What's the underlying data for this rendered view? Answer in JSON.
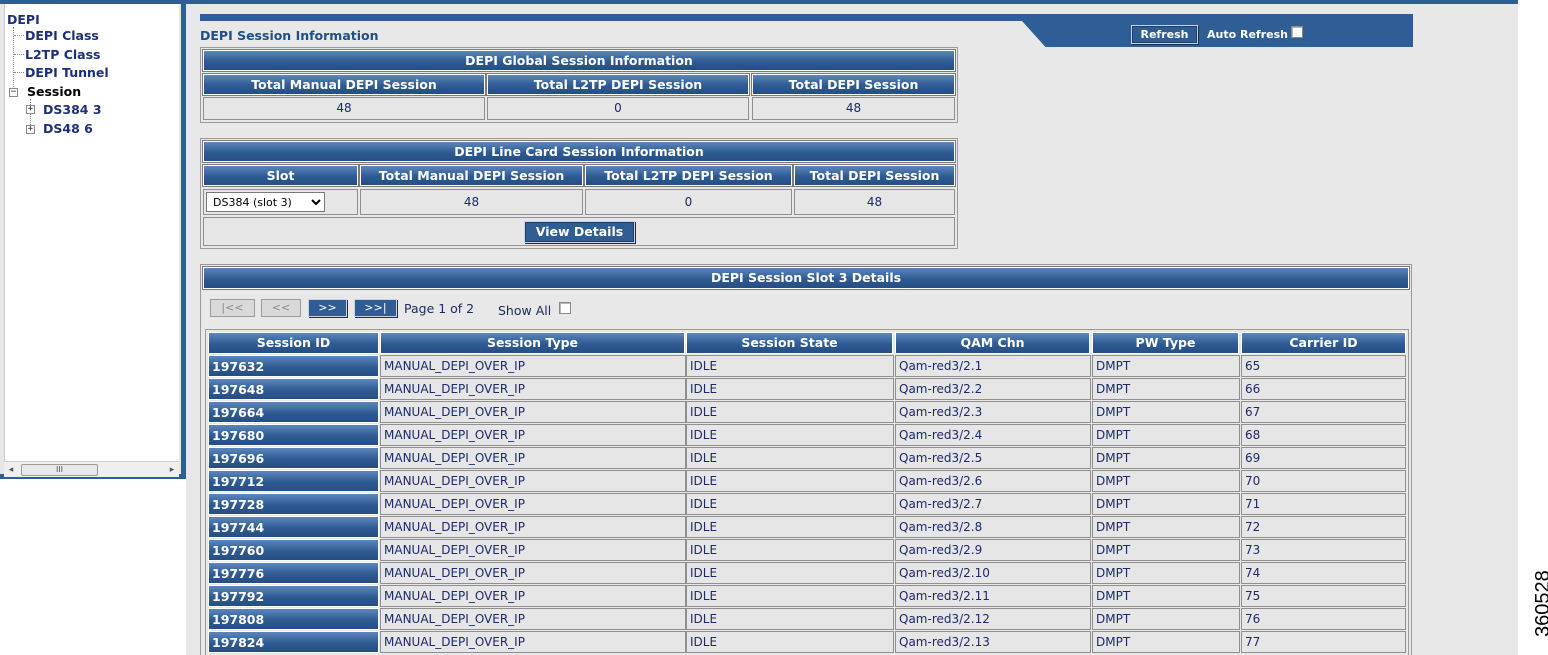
{
  "tree": {
    "root": "DEPI",
    "items": [
      {
        "label": "DEPI Class"
      },
      {
        "label": "L2TP Class"
      },
      {
        "label": "DEPI Tunnel"
      },
      {
        "label": "Session",
        "expander": "⊟"
      },
      {
        "label": "DS384 3",
        "expander": "⊞"
      },
      {
        "label": "DS48 6",
        "expander": "⊞"
      }
    ],
    "scroll_thumb": "III"
  },
  "header": {
    "title": "DEPI Session Information",
    "refresh_label": "Refresh",
    "auto_refresh_label": "Auto Refresh"
  },
  "global": {
    "title": "DEPI Global Session Information",
    "columns": [
      "Total Manual DEPI Session",
      "Total L2TP DEPI Session",
      "Total DEPI Session"
    ],
    "values": [
      "48",
      "0",
      "48"
    ]
  },
  "linecard": {
    "title": "DEPI Line Card Session Information",
    "columns": [
      "Slot",
      "Total Manual DEPI Session",
      "Total L2TP DEPI Session",
      "Total DEPI Session"
    ],
    "slot_selected": "DS384 (slot 3)",
    "values": [
      "48",
      "0",
      "48"
    ],
    "view_details_label": "View Details"
  },
  "details": {
    "title": "DEPI Session Slot 3 Details",
    "pager": {
      "first": "|<<",
      "prev": "<<",
      "next": ">>",
      "last": ">>|",
      "page_text": "Page 1 of 2",
      "show_all_label": "Show All"
    },
    "columns": [
      "Session ID",
      "Session Type",
      "Session State",
      "QAM Chn",
      "PW Type",
      "Carrier ID"
    ],
    "rows": [
      [
        "197632",
        "MANUAL_DEPI_OVER_IP",
        "IDLE",
        "Qam-red3/2.1",
        "DMPT",
        "65"
      ],
      [
        "197648",
        "MANUAL_DEPI_OVER_IP",
        "IDLE",
        "Qam-red3/2.2",
        "DMPT",
        "66"
      ],
      [
        "197664",
        "MANUAL_DEPI_OVER_IP",
        "IDLE",
        "Qam-red3/2.3",
        "DMPT",
        "67"
      ],
      [
        "197680",
        "MANUAL_DEPI_OVER_IP",
        "IDLE",
        "Qam-red3/2.4",
        "DMPT",
        "68"
      ],
      [
        "197696",
        "MANUAL_DEPI_OVER_IP",
        "IDLE",
        "Qam-red3/2.5",
        "DMPT",
        "69"
      ],
      [
        "197712",
        "MANUAL_DEPI_OVER_IP",
        "IDLE",
        "Qam-red3/2.6",
        "DMPT",
        "70"
      ],
      [
        "197728",
        "MANUAL_DEPI_OVER_IP",
        "IDLE",
        "Qam-red3/2.7",
        "DMPT",
        "71"
      ],
      [
        "197744",
        "MANUAL_DEPI_OVER_IP",
        "IDLE",
        "Qam-red3/2.8",
        "DMPT",
        "72"
      ],
      [
        "197760",
        "MANUAL_DEPI_OVER_IP",
        "IDLE",
        "Qam-red3/2.9",
        "DMPT",
        "73"
      ],
      [
        "197776",
        "MANUAL_DEPI_OVER_IP",
        "IDLE",
        "Qam-red3/2.10",
        "DMPT",
        "74"
      ],
      [
        "197792",
        "MANUAL_DEPI_OVER_IP",
        "IDLE",
        "Qam-red3/2.11",
        "DMPT",
        "75"
      ],
      [
        "197808",
        "MANUAL_DEPI_OVER_IP",
        "IDLE",
        "Qam-red3/2.12",
        "DMPT",
        "76"
      ],
      [
        "197824",
        "MANUAL_DEPI_OVER_IP",
        "IDLE",
        "Qam-red3/2.13",
        "DMPT",
        "77"
      ]
    ]
  },
  "figure_id": "360528"
}
